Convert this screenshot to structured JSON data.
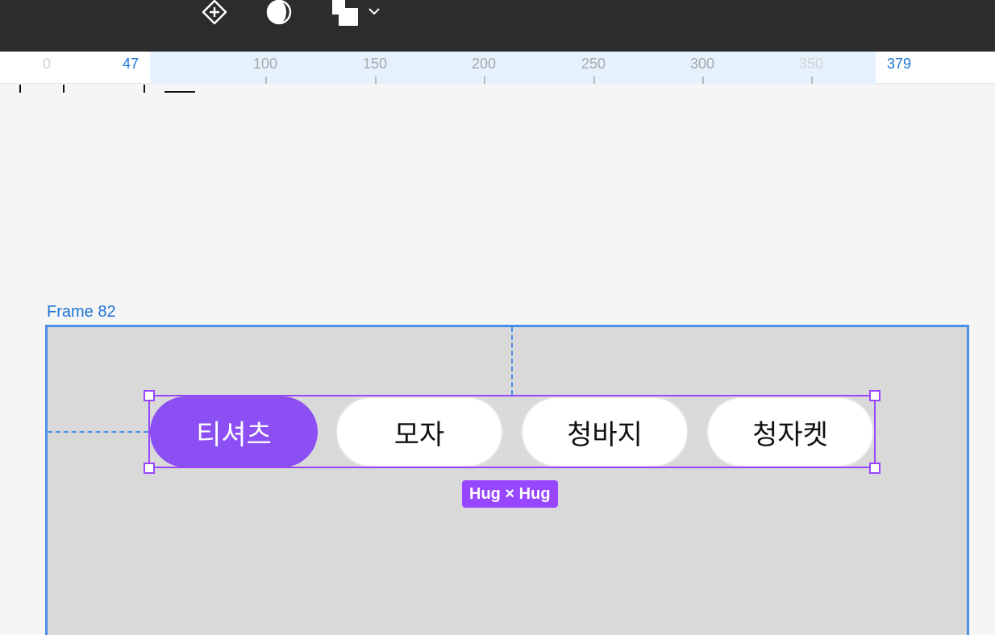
{
  "toolbar": {
    "tools": [
      {
        "name": "component-icon"
      },
      {
        "name": "contrast-icon"
      },
      {
        "name": "boolean-ops-icon"
      },
      {
        "name": "chevron-down-icon"
      }
    ],
    "background": "#2c2c2c"
  },
  "ruler": {
    "selection_start": "47",
    "selection_end": "379",
    "ticks": [
      "0",
      "100",
      "150",
      "200",
      "250",
      "300",
      "350"
    ]
  },
  "frame": {
    "label": "Frame 82",
    "border_color": "#4a90e8"
  },
  "chips": [
    {
      "label": "티셔츠",
      "active": true
    },
    {
      "label": "모자",
      "active": false
    },
    {
      "label": "청바지",
      "active": false
    },
    {
      "label": "청자켓",
      "active": false
    }
  ],
  "selection": {
    "size_label": "Hug × Hug",
    "color": "#9747ff"
  },
  "colors": {
    "active_chip": "#8b4ff3",
    "canvas": "#f5f5f5",
    "frame_fill": "#d9d9d9"
  }
}
